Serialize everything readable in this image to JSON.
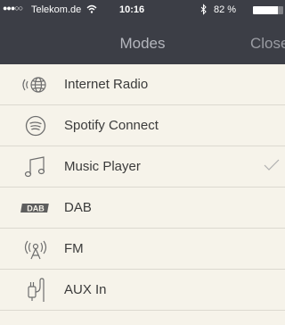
{
  "status_bar": {
    "signal": "●●●○○",
    "carrier": "Telekom.de",
    "wifi_icon": "wifi-icon",
    "time": "10:16",
    "bluetooth_icon": "bluetooth-icon",
    "battery": "82 %",
    "battery_level": 0.82
  },
  "header": {
    "title": "Modes",
    "close_label": "Close",
    "background": "#3c3e46"
  },
  "modes": [
    {
      "label": "Internet Radio",
      "icon": "internet-radio-icon",
      "selected": false
    },
    {
      "label": "Spotify Connect",
      "icon": "spotify-icon",
      "selected": false
    },
    {
      "label": "Music Player",
      "icon": "music-note-icon",
      "selected": true
    },
    {
      "label": "DAB",
      "icon": "dab-icon",
      "icon_text": "DAB",
      "selected": false
    },
    {
      "label": "FM",
      "icon": "fm-antenna-icon",
      "selected": false
    },
    {
      "label": "AUX In",
      "icon": "aux-plug-icon",
      "selected": false
    }
  ],
  "colors": {
    "list_background": "#f6f3ea",
    "separator": "#dcd9d0",
    "text": "#3b3b3b",
    "icon": "#6e6e6e",
    "check": "#b0b0b0"
  }
}
